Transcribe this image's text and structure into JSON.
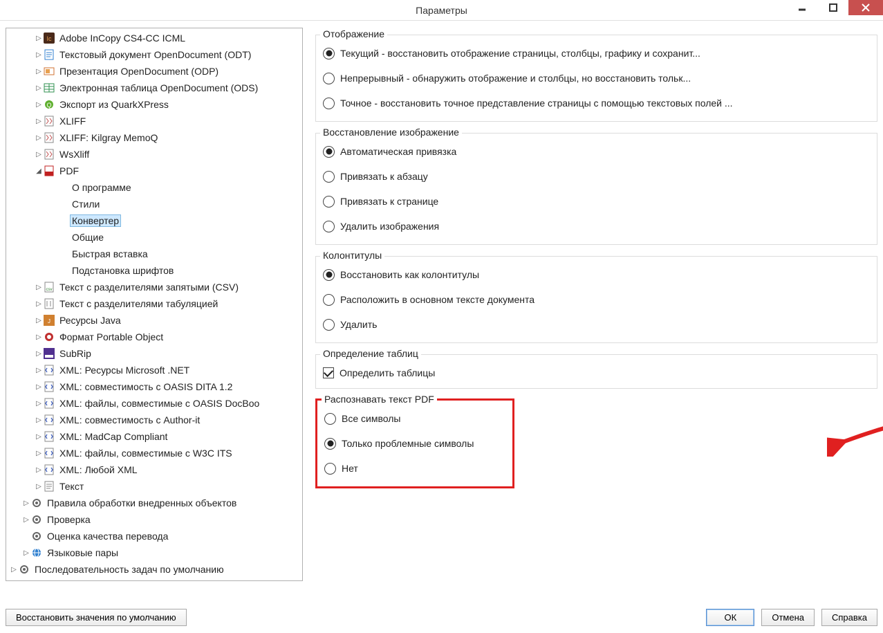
{
  "title": "Параметры",
  "tree": {
    "items": [
      {
        "depth": 2,
        "exp": "▷",
        "icon": "incopy",
        "label": "Adobe InCopy CS4-CC ICML"
      },
      {
        "depth": 2,
        "exp": "▷",
        "icon": "odt",
        "label": "Текстовый документ OpenDocument (ODT)"
      },
      {
        "depth": 2,
        "exp": "▷",
        "icon": "odp",
        "label": "Презентация OpenDocument (ODP)"
      },
      {
        "depth": 2,
        "exp": "▷",
        "icon": "ods",
        "label": "Электронная таблица OpenDocument (ODS)"
      },
      {
        "depth": 2,
        "exp": "▷",
        "icon": "quark",
        "label": "Экспорт из QuarkXPress"
      },
      {
        "depth": 2,
        "exp": "▷",
        "icon": "xliff",
        "label": "XLIFF"
      },
      {
        "depth": 2,
        "exp": "▷",
        "icon": "xliff",
        "label": "XLIFF: Kilgray MemoQ"
      },
      {
        "depth": 2,
        "exp": "▷",
        "icon": "xliff",
        "label": "WsXliff"
      },
      {
        "depth": 2,
        "exp": "◢",
        "icon": "pdf",
        "label": "PDF"
      },
      {
        "depth": 3,
        "exp": "",
        "icon": "",
        "label": "О программе"
      },
      {
        "depth": 3,
        "exp": "",
        "icon": "",
        "label": "Стили"
      },
      {
        "depth": 3,
        "exp": "",
        "icon": "",
        "label": "Конвертер",
        "selected": true
      },
      {
        "depth": 3,
        "exp": "",
        "icon": "",
        "label": "Общие"
      },
      {
        "depth": 3,
        "exp": "",
        "icon": "",
        "label": "Быстрая вставка"
      },
      {
        "depth": 3,
        "exp": "",
        "icon": "",
        "label": "Подстановка шрифтов"
      },
      {
        "depth": 2,
        "exp": "▷",
        "icon": "csv",
        "label": "Текст с разделителями запятыми (CSV)"
      },
      {
        "depth": 2,
        "exp": "▷",
        "icon": "tsv",
        "label": "Текст с разделителями табуляцией"
      },
      {
        "depth": 2,
        "exp": "▷",
        "icon": "java",
        "label": "Ресурсы Java"
      },
      {
        "depth": 2,
        "exp": "▷",
        "icon": "po",
        "label": "Формат Portable Object"
      },
      {
        "depth": 2,
        "exp": "▷",
        "icon": "subrip",
        "label": "SubRip"
      },
      {
        "depth": 2,
        "exp": "▷",
        "icon": "xml",
        "label": "XML: Ресурсы Microsoft .NET"
      },
      {
        "depth": 2,
        "exp": "▷",
        "icon": "xml",
        "label": "XML: совместимость с OASIS DITA 1.2"
      },
      {
        "depth": 2,
        "exp": "▷",
        "icon": "xml",
        "label": "XML: файлы, совместимые с OASIS DocBoo"
      },
      {
        "depth": 2,
        "exp": "▷",
        "icon": "xml",
        "label": "XML: совместимость с Author-it"
      },
      {
        "depth": 2,
        "exp": "▷",
        "icon": "xml",
        "label": "XML: MadCap Compliant"
      },
      {
        "depth": 2,
        "exp": "▷",
        "icon": "xml",
        "label": "XML: файлы, совместимые с W3C ITS"
      },
      {
        "depth": 2,
        "exp": "▷",
        "icon": "xml",
        "label": "XML: Любой XML"
      },
      {
        "depth": 2,
        "exp": "▷",
        "icon": "txt",
        "label": "Текст"
      },
      {
        "depth": 1,
        "exp": "▷",
        "icon": "gear",
        "label": "Правила обработки внедренных объектов"
      },
      {
        "depth": 1,
        "exp": "▷",
        "icon": "gear",
        "label": "Проверка"
      },
      {
        "depth": 1,
        "exp": "",
        "icon": "gear",
        "label": "Оценка качества перевода"
      },
      {
        "depth": 1,
        "exp": "▷",
        "icon": "lang",
        "label": "Языковые пары"
      },
      {
        "depth": 0,
        "exp": "▷",
        "icon": "gear",
        "label": "Последовательность задач по умолчанию"
      }
    ]
  },
  "groups": {
    "display": {
      "legend": "Отображение",
      "opts": [
        {
          "label": "Текущий - восстановить отображение страницы, столбцы, графику и сохранит...",
          "checked": true
        },
        {
          "label": "Непрерывный - обнаружить отображение и столбцы, но восстановить тольк...",
          "checked": false
        },
        {
          "label": "Точное - восстановить точное представление страницы с помощью текстовых полей ...",
          "checked": false
        }
      ]
    },
    "imgrec": {
      "legend": "Восстановление изображение",
      "opts": [
        {
          "label": "Автоматическая привязка",
          "checked": true
        },
        {
          "label": "Привязать к абзацу",
          "checked": false
        },
        {
          "label": "Привязать к странице",
          "checked": false
        },
        {
          "label": "Удалить изображения",
          "checked": false
        }
      ]
    },
    "headfoot": {
      "legend": "Колонтитулы",
      "opts": [
        {
          "label": "Восстановить как колонтитулы",
          "checked": true
        },
        {
          "label": "Расположить в основном тексте документа",
          "checked": false
        },
        {
          "label": "Удалить",
          "checked": false
        }
      ]
    },
    "tables": {
      "legend": "Определение таблиц",
      "checkbox": {
        "label": "Определить таблицы",
        "checked": true
      }
    },
    "ocr": {
      "legend": "Распознавать текст PDF",
      "opts": [
        {
          "label": "Все символы",
          "checked": false
        },
        {
          "label": "Только проблемные символы",
          "checked": true
        },
        {
          "label": "Нет",
          "checked": false
        }
      ]
    }
  },
  "buttons": {
    "restore": "Восстановить значения по умолчанию",
    "ok": "ОК",
    "cancel": "Отмена",
    "help": "Справка"
  }
}
